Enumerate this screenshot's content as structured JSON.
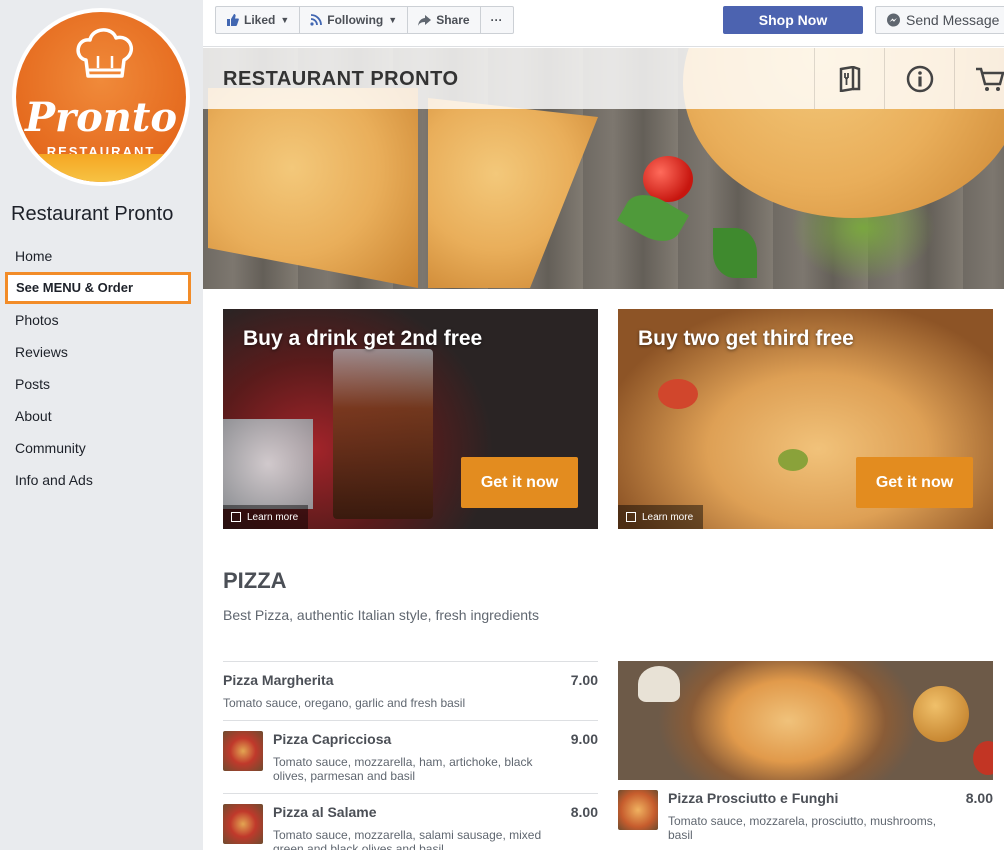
{
  "sidebar": {
    "logo": {
      "script_text": "Pronto",
      "sub_text": "RESTAURANT"
    },
    "page_name": "Restaurant Pronto",
    "nav": [
      {
        "label": "Home"
      },
      {
        "label": "See MENU & Order"
      },
      {
        "label": "Photos"
      },
      {
        "label": "Reviews"
      },
      {
        "label": "Posts"
      },
      {
        "label": "About"
      },
      {
        "label": "Community"
      },
      {
        "label": "Info and Ads"
      }
    ],
    "active_index": 1
  },
  "topbar": {
    "liked": "Liked",
    "following": "Following",
    "share": "Share",
    "more": "···",
    "shop_now": "Shop Now",
    "send_message": "Send Message"
  },
  "hero": {
    "title": "RESTAURANT PRONTO",
    "icons": [
      "menu-icon",
      "info-icon",
      "cart-icon"
    ]
  },
  "promos": [
    {
      "title": "Buy a drink get 2nd free",
      "cta": "Get it now",
      "learn_more": "Learn more"
    },
    {
      "title": "Buy two get third free",
      "cta": "Get it now",
      "learn_more": "Learn more"
    }
  ],
  "section": {
    "title": "PIZZA",
    "description": "Best Pizza, authentic Italian style, fresh ingredients"
  },
  "menu_items": [
    {
      "name": "Pizza Margherita",
      "desc": "Tomato sauce, oregano, garlic and fresh basil",
      "price": "7.00"
    },
    {
      "name": "Pizza Capricciosa",
      "desc": "Tomato sauce, mozzarella, ham, artichoke, black olives, parmesan and basil",
      "price": "9.00"
    },
    {
      "name": "Pizza al Salame",
      "desc": "Tomato sauce, mozzarella, salami sausage, mixed green and black olives and basil",
      "price": "8.00"
    }
  ],
  "feature_item": {
    "name": "Pizza Prosciutto e Funghi",
    "desc": "Tomato sauce, mozzarela, prosciutto, mushrooms, basil",
    "price": "8.00"
  },
  "colors": {
    "accent_orange": "#e38c1f",
    "shop_blue": "#4c63b0",
    "sidebar_bg": "#e9ebee",
    "active_border": "#f28c28"
  }
}
